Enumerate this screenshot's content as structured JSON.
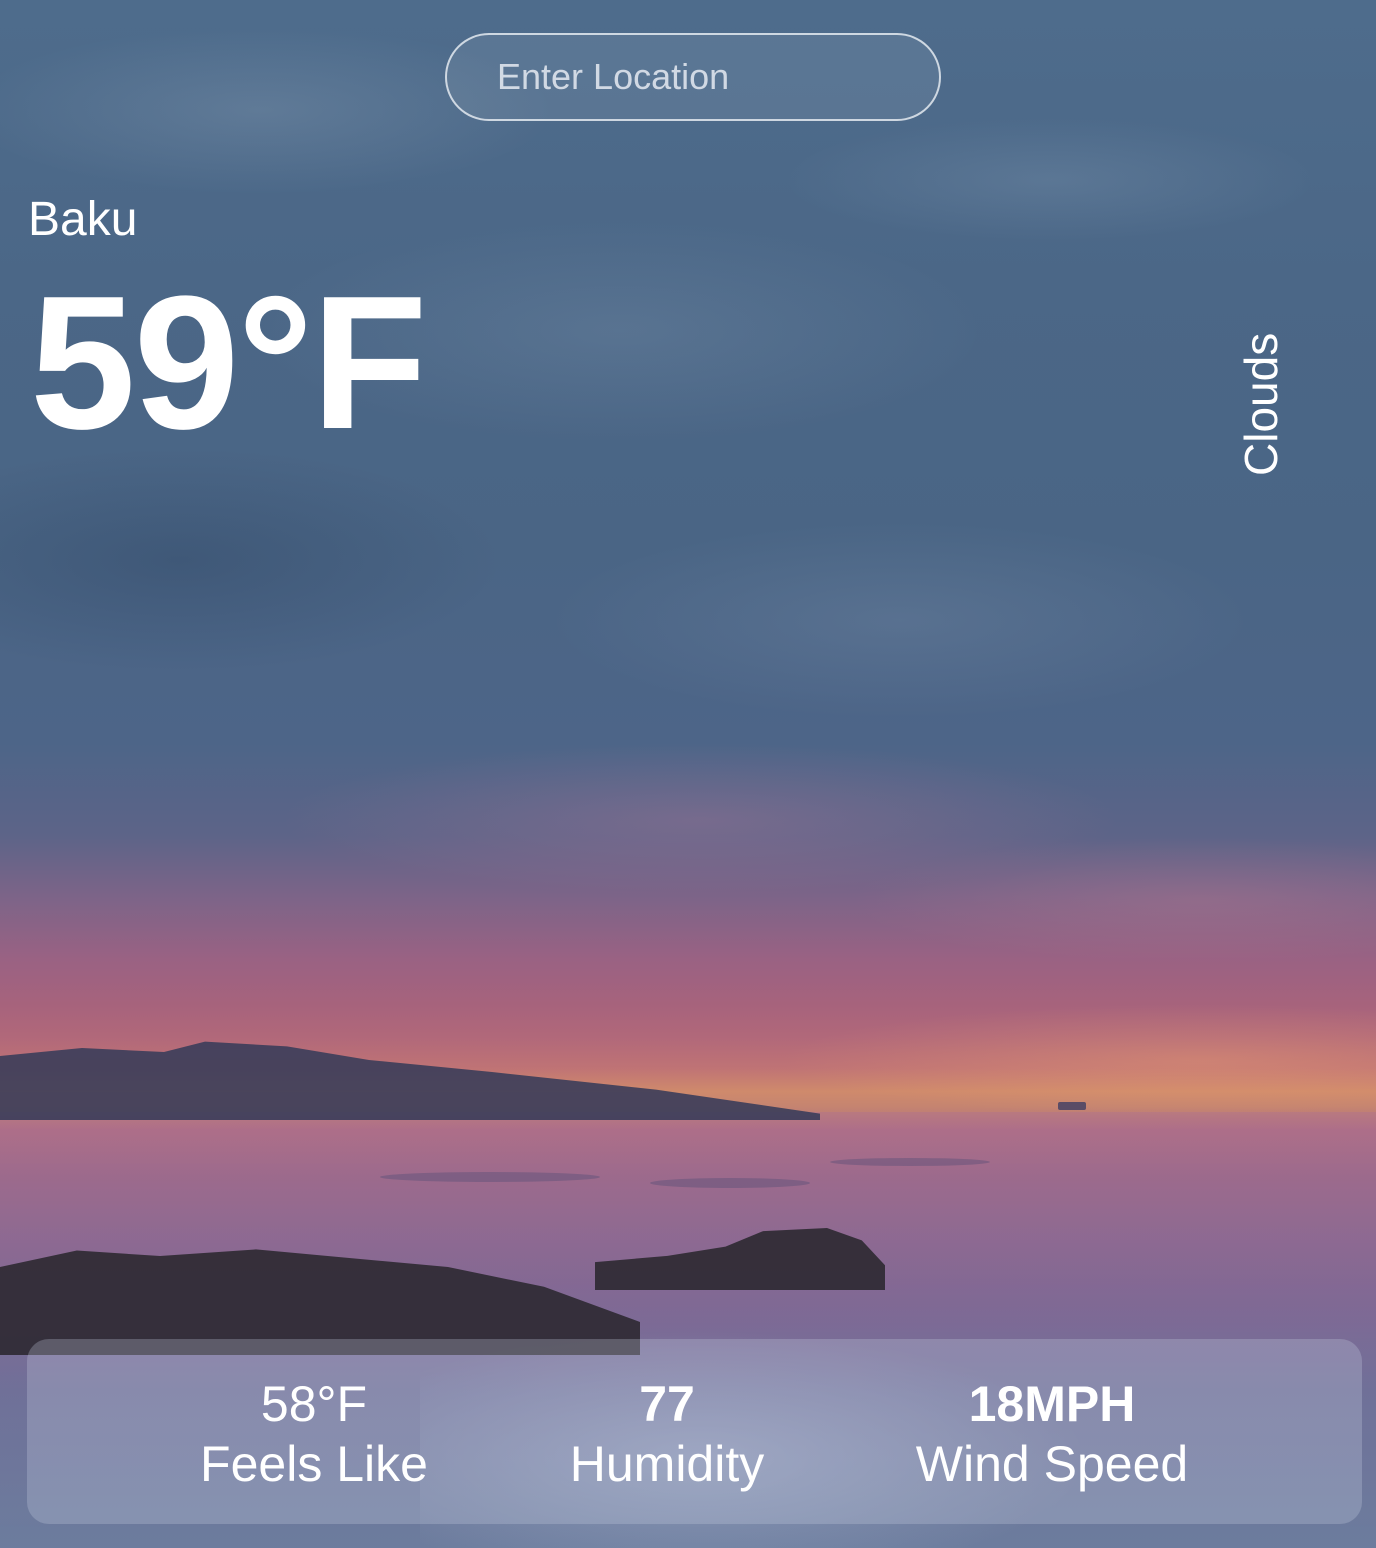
{
  "search": {
    "placeholder": "Enter Location",
    "value": ""
  },
  "location": {
    "city": "Baku"
  },
  "current": {
    "temperature": "59°F",
    "condition": "Clouds"
  },
  "details": {
    "feels_like_value": "58°F",
    "feels_like_label": "Feels Like",
    "humidity_value": "77",
    "humidity_label": "Humidity",
    "wind_value": "18MPH",
    "wind_label": "Wind Speed"
  },
  "colors": {
    "text": "#ffffff",
    "panel": "rgba(200,210,225,0.28)"
  }
}
